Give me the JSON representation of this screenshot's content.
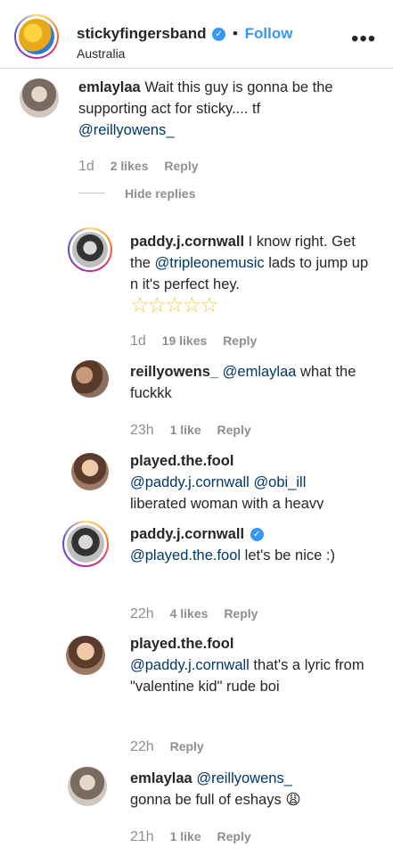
{
  "header": {
    "username": "stickyfingersband",
    "separator": "•",
    "follow_label": "Follow",
    "location": "Australia",
    "more_label": "•••"
  },
  "top_comment": {
    "username": "emlaylaa",
    "text": "Wait this guy is gonna be the supporting act for sticky.... tf",
    "mention": "@reillyowens_",
    "time": "1d",
    "likes": "2 likes",
    "reply": "Reply",
    "hide_replies": "Hide replies"
  },
  "replies": [
    {
      "username": "paddy.j.cornwall",
      "text_before": " I know right. Get the ",
      "mention": "@tripleonemusic",
      "text_after": " lads to jump up n it's perfect hey.",
      "emoji": "☆☆☆☆☆",
      "time": "1d",
      "likes": "19 likes",
      "reply": "Reply"
    },
    {
      "username": "reillyowens_",
      "mention": "@emlaylaa",
      "text": " what the fuckkk",
      "time": "23h",
      "likes": "1 like",
      "reply": "Reply"
    },
    {
      "username": "played.the.fool",
      "mention1": "@paddy.j.cornwall",
      "mention2": "@obi_ill",
      "text": "liberated woman with a heavy"
    },
    {
      "username": "paddy.j.cornwall",
      "mention": "@played.the.fool",
      "text": " let's be nice :)",
      "time": "22h",
      "likes": "4 likes",
      "reply": "Reply"
    },
    {
      "username": "played.the.fool",
      "mention": "@paddy.j.cornwall",
      "text": " that's a lyric from \"valentine kid\" rude boi",
      "time": "22h",
      "reply": "Reply"
    },
    {
      "username": "emlaylaa",
      "mention": "@reillyowens_",
      "text": "gonna be full of eshays",
      "emoji": "😩",
      "time": "21h",
      "likes": "1 like",
      "reply": "Reply"
    }
  ],
  "colors": {
    "link": "#3897f0",
    "mention": "#00376b",
    "meta": "#8e8e8e"
  }
}
